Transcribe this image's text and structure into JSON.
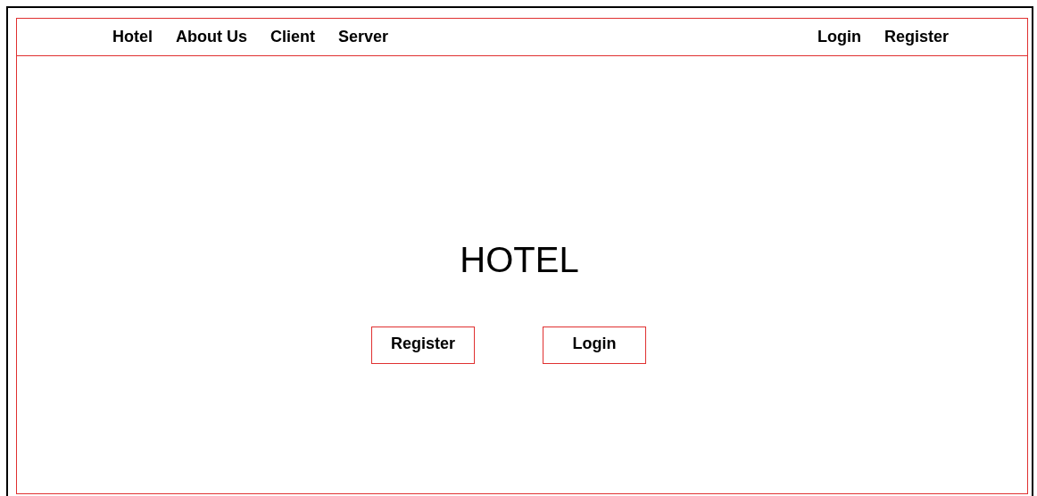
{
  "nav": {
    "left": [
      "Hotel",
      "About Us",
      "Client",
      "Server"
    ],
    "right": [
      "Login",
      "Register"
    ]
  },
  "hero": {
    "title": "HOTEL",
    "buttons": [
      "Register",
      "Login"
    ]
  }
}
